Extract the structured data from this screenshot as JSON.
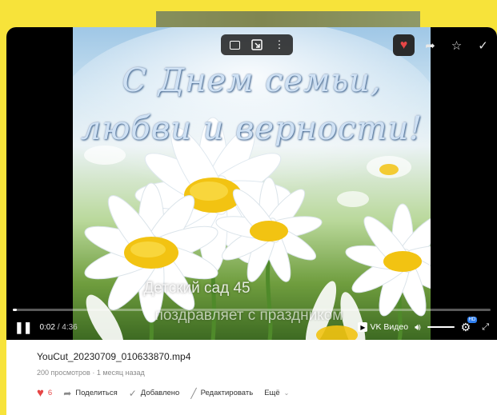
{
  "player": {
    "greeting_line1": "С Днем семьи,",
    "greeting_line2": "любви и верности!",
    "subtitle_line1": "Детский сад 45",
    "subtitle_line2": "поздравляет с праздником",
    "progress": 0.008,
    "time_current": "0:02",
    "time_separator": " / ",
    "time_total": "4:36",
    "brand": "VK Видео",
    "quality_badge": "HD"
  },
  "video": {
    "title": "YouCut_20230709_010633870.mp4",
    "views": "200 просмотров",
    "dot": " · ",
    "uploaded": "1 месяц назад"
  },
  "actions": {
    "like_count": "6",
    "share_label": "Поделиться",
    "added_label": "Добавлено",
    "edit_label": "Редактировать",
    "more_label": "Ещё"
  },
  "colors": {
    "page_background": "#f7e33a",
    "like_red": "#e64646",
    "hd_blue": "#2f7ff0"
  }
}
